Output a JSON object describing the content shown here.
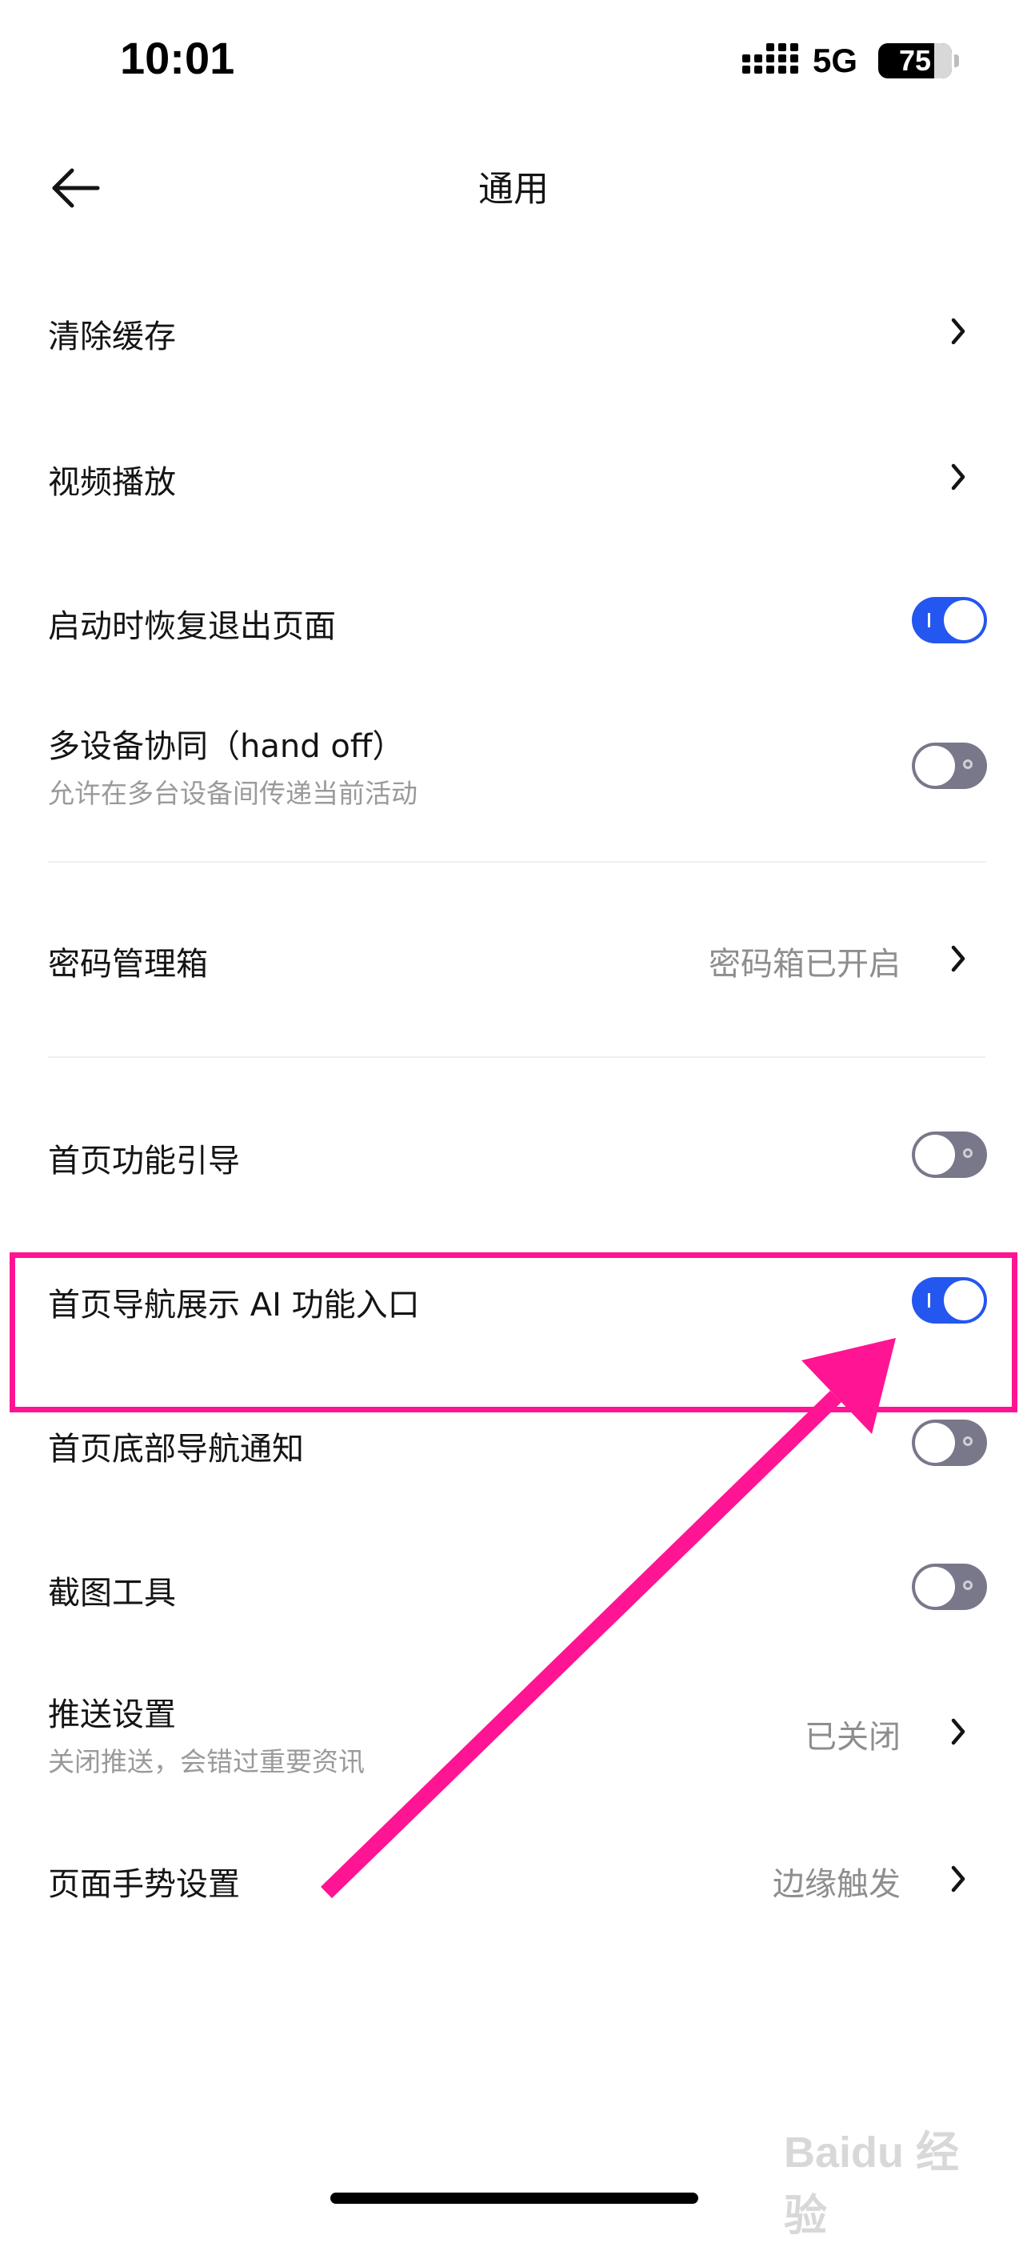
{
  "status_bar": {
    "time": "10:01",
    "network": "5G",
    "battery": "75"
  },
  "header": {
    "title": "通用",
    "back_icon": "arrow-left-icon"
  },
  "settings": {
    "clear_cache": {
      "label": "清除缓存"
    },
    "video_playback": {
      "label": "视频播放"
    },
    "restore_pages": {
      "label": "启动时恢复退出页面",
      "enabled": true
    },
    "handoff": {
      "label": "多设备协同（hand off）",
      "subtitle": "允许在多台设备间传递当前活动",
      "enabled": false
    },
    "password_manager": {
      "label": "密码管理箱",
      "value": "密码箱已开启"
    },
    "home_guide": {
      "label": "首页功能引导",
      "enabled": false
    },
    "home_ai_entry": {
      "label": "首页导航展示 AI 功能入口",
      "enabled": true
    },
    "home_bottom_nav_notice": {
      "label": "首页底部导航通知",
      "enabled": false
    },
    "screenshot_tool": {
      "label": "截图工具",
      "enabled": false
    },
    "push_settings": {
      "label": "推送设置",
      "subtitle": "关闭推送，会错过重要资讯",
      "value": "已关闭"
    },
    "gesture_settings": {
      "label": "页面手势设置",
      "value": "边缘触发"
    }
  },
  "annotation_color": "#ff1493",
  "toggle_on_color": "#2456f0",
  "watermark": "Baidu 经验"
}
